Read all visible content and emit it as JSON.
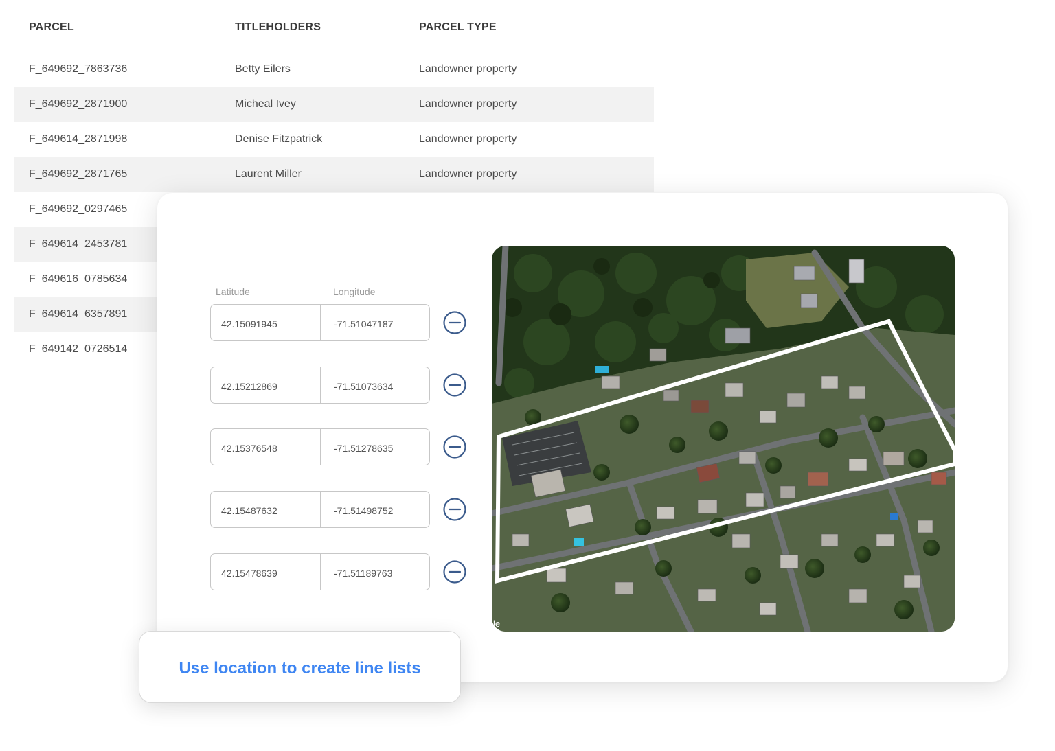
{
  "table": {
    "headers": [
      "PARCEL",
      "TITLEHOLDERS",
      "PARCEL TYPE"
    ],
    "rows": [
      {
        "parcel": "F_649692_7863736",
        "holder": "Betty Eilers",
        "type": "Landowner property"
      },
      {
        "parcel": "F_649692_2871900",
        "holder": "Micheal Ivey",
        "type": "Landowner property"
      },
      {
        "parcel": "F_649614_2871998",
        "holder": "Denise Fitzpatrick",
        "type": "Landowner property"
      },
      {
        "parcel": "F_649692_2871765",
        "holder": "Laurent Miller",
        "type": "Landowner property"
      },
      {
        "parcel": "F_649692_0297465"
      },
      {
        "parcel": "F_649614_2453781"
      },
      {
        "parcel": "F_649616_0785634"
      },
      {
        "parcel": "F_649614_6357891"
      },
      {
        "parcel": "F_649142_0726514"
      }
    ]
  },
  "coords": {
    "lat_label": "Latitude",
    "lon_label": "Longitude",
    "points": [
      {
        "lat": "42.15091945",
        "lon": "-71.51047187"
      },
      {
        "lat": "42.15212869",
        "lon": "-71.51073634"
      },
      {
        "lat": "42.15376548",
        "lon": "-71.51278635"
      },
      {
        "lat": "42.15487632",
        "lon": "-71.51498752"
      },
      {
        "lat": "42.15478639",
        "lon": "-71.51189763"
      }
    ],
    "remove_icon": "minus-circle-icon",
    "icon_color": "#3b5b8c"
  },
  "map": {
    "attribution": "le"
  },
  "cta": {
    "label": "Use location to create line lists",
    "color": "#3f86f2"
  }
}
